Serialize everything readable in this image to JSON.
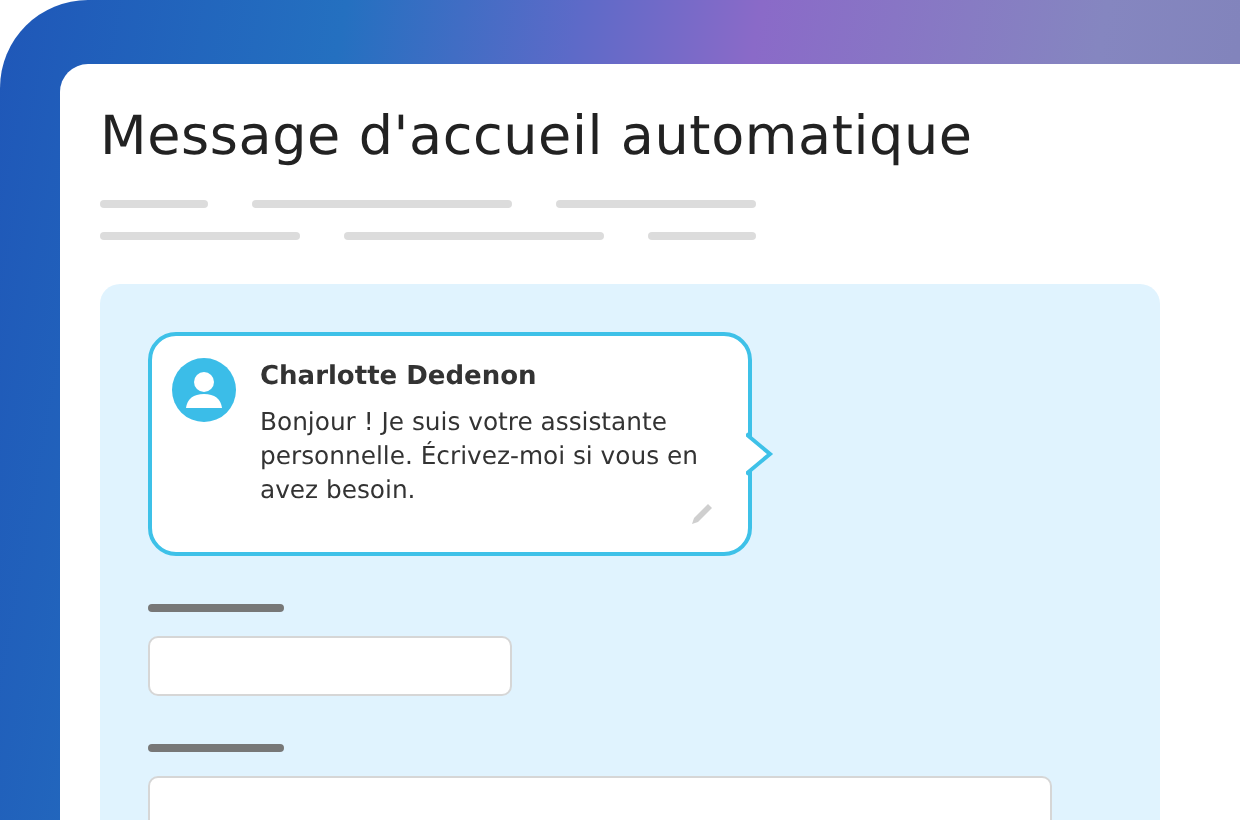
{
  "page": {
    "title": "Message d'accueil automatique"
  },
  "welcome_bubble": {
    "sender": "Charlotte Dedenon",
    "message": "Bonjour ! Je suis votre assistante personnelle. Écrivez-moi si vous en avez besoin."
  }
}
